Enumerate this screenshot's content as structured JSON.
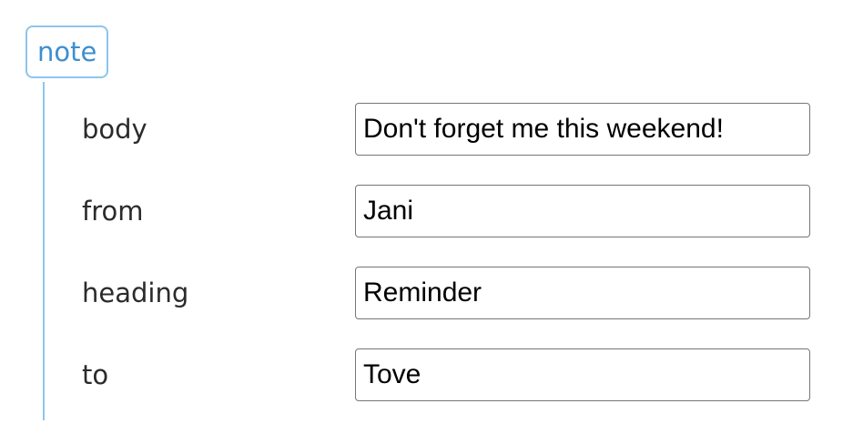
{
  "node": {
    "tag": "note"
  },
  "fields": [
    {
      "label": "body",
      "value": "Don't forget me this weekend!"
    },
    {
      "label": "from",
      "value": "Jani"
    },
    {
      "label": "heading",
      "value": "Reminder"
    },
    {
      "label": "to",
      "value": "Tove"
    }
  ],
  "colors": {
    "accent": "#3d8fd1",
    "accent_border": "#8cc6ee",
    "input_border": "#767676"
  }
}
